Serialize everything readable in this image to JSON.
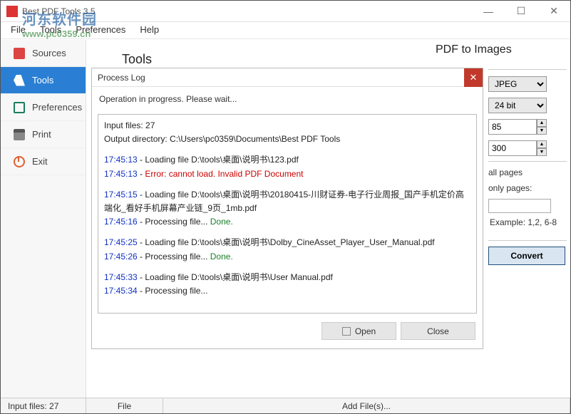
{
  "window": {
    "title": "Best PDF Tools 3.5"
  },
  "menubar": {
    "file": "File",
    "tools": "Tools",
    "preferences": "Preferences",
    "help": "Help"
  },
  "sidebar": {
    "sources": "Sources",
    "tools": "Tools",
    "preferences": "Preferences",
    "print": "Print",
    "exit": "Exit"
  },
  "watermark": {
    "cn": "河东软件园",
    "en": "www.pc0359.cn"
  },
  "heading_tools": "Tools",
  "heading_right": "PDF to Images",
  "dialog": {
    "title": "Process Log",
    "status": "Operation in progress. Please wait...",
    "input_files_label": "Input files: 27",
    "output_dir": "Output directory: C:\\Users\\pc0359\\Documents\\Best PDF Tools",
    "lines": [
      {
        "ts": "17:45:13",
        "rest": " - Loading file D:\\tools\\桌面\\说明书\\123.pdf"
      },
      {
        "ts": "17:45:13",
        "rest": " - ",
        "err": "Error: cannot load. Invalid PDF Document"
      },
      {
        "ts": "17:45:15",
        "rest": " - Loading file D:\\tools\\桌面\\说明书\\20180415-川财证券-电子行业周报_国产手机定价高端化_看好手机屏幕产业链_9页_1mb.pdf"
      },
      {
        "ts": "17:45:16",
        "rest": " - Processing file... ",
        "done": "Done."
      },
      {
        "ts": "17:45:25",
        "rest": " - Loading file D:\\tools\\桌面\\说明书\\Dolby_CineAsset_Player_User_Manual.pdf"
      },
      {
        "ts": "17:45:26",
        "rest": " - Processing file... ",
        "done": "Done."
      },
      {
        "ts": "17:45:33",
        "rest": " - Loading file D:\\tools\\桌面\\说明书\\User Manual.pdf"
      },
      {
        "ts": "17:45:34",
        "rest": " - Processing file... "
      }
    ],
    "open": "Open",
    "close": "Close"
  },
  "right": {
    "format": "JPEG",
    "depth": "24 bit",
    "quality": "85",
    "dpi": "300",
    "all_pages": "all pages",
    "only_pages": "only pages:",
    "example": "Example: 1,2, 6-8",
    "convert": "Convert"
  },
  "statusbar": {
    "input": "Input files: 27",
    "file": "File",
    "add": "Add File(s)..."
  }
}
